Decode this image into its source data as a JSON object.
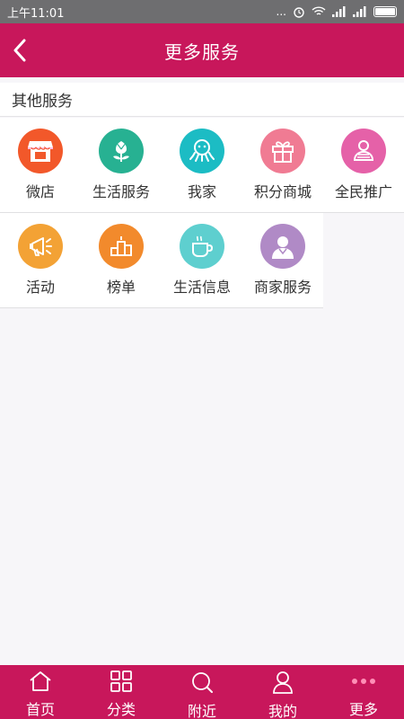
{
  "status": {
    "time": "上午11:01",
    "dots": "...",
    "signal_icon": "signal-icon",
    "battery_icon": "battery-icon"
  },
  "nav": {
    "title": "更多服务",
    "back_icon": "chevron-left-icon"
  },
  "section": {
    "title": "其他服务"
  },
  "services": [
    {
      "label": "微店",
      "icon": "storefront-icon",
      "color": "#f2582a"
    },
    {
      "label": "生活服务",
      "icon": "tulip-icon",
      "color": "#27b192"
    },
    {
      "label": "我家",
      "icon": "octopus-icon",
      "color": "#1cbcc4"
    },
    {
      "label": "积分商城",
      "icon": "gift-icon",
      "color": "#f07b93"
    },
    {
      "label": "全民推广",
      "icon": "person-icon",
      "color": "#e561a8"
    },
    {
      "label": "活动",
      "icon": "megaphone-icon",
      "color": "#f3a235"
    },
    {
      "label": "榜单",
      "icon": "podium-icon",
      "color": "#f28a2c"
    },
    {
      "label": "生活信息",
      "icon": "coffee-cup-icon",
      "color": "#5ecfcf"
    },
    {
      "label": "商家服务",
      "icon": "merchant-avatar-icon",
      "color": "#b08ac6"
    }
  ],
  "tabs": [
    {
      "label": "首页",
      "icon": "home-icon"
    },
    {
      "label": "分类",
      "icon": "grid-icon"
    },
    {
      "label": "附近",
      "icon": "search-icon"
    },
    {
      "label": "我的",
      "icon": "user-icon"
    },
    {
      "label": "更多",
      "icon": "more-dots-icon",
      "active": true,
      "active_color": "#ff8fb6"
    }
  ]
}
